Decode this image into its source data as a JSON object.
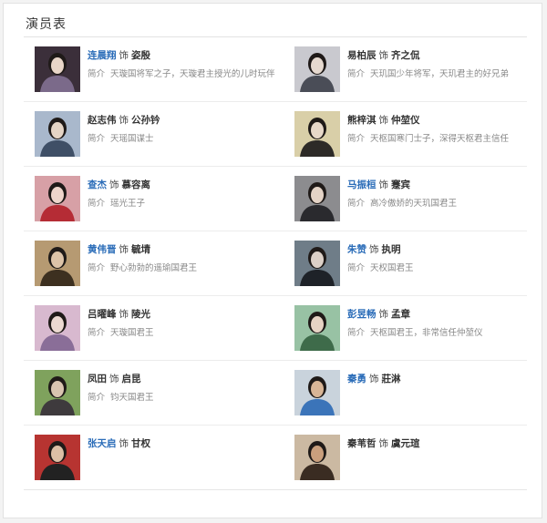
{
  "panel": {
    "title": "演员表"
  },
  "intro_label": "简介",
  "shi": "饰",
  "rows": [
    {
      "left": {
        "actor": "连晨翔",
        "linked": true,
        "role": "姿殷",
        "intro": "天璇国将军之子，天璇君主授光的儿时玩伴",
        "palette": [
          "#3b2f3a",
          "#7b6a8a",
          "#e9d6c8"
        ]
      },
      "right": {
        "actor": "易柏辰",
        "linked": false,
        "role": "齐之侃",
        "intro": "天玑国少年将军，天玑君主的好兄弟",
        "palette": [
          "#c9c9cf",
          "#4a4d57",
          "#e6d9cf"
        ]
      }
    },
    {
      "left": {
        "actor": "赵志伟",
        "linked": false,
        "role": "公孙钤",
        "intro": "天瑶国谋士",
        "palette": [
          "#a9b8cc",
          "#3f4f66",
          "#e5d4c5"
        ]
      },
      "right": {
        "actor": "熊梓淇",
        "linked": false,
        "role": "仲堃仪",
        "intro": "天枢国寒门士子，深得天枢君主信任",
        "palette": [
          "#d9cfa8",
          "#2d2a27",
          "#e7d8c9"
        ]
      }
    },
    {
      "left": {
        "actor": "查杰",
        "linked": true,
        "role": "慕容离",
        "intro": "瑶光王子",
        "palette": [
          "#d7a0a6",
          "#b52c35",
          "#eed5cb"
        ]
      },
      "right": {
        "actor": "马振桓",
        "linked": true,
        "role": "蹇宾",
        "intro": "高冷傲娇的天玑国君王",
        "palette": [
          "#8c8c8f",
          "#2a2a2e",
          "#e4d3c6"
        ]
      }
    },
    {
      "left": {
        "actor": "黄伟晋",
        "linked": true,
        "role": "毓埥",
        "intro": "野心勃勃的遥瑜国君王",
        "palette": [
          "#b69a72",
          "#3d3020",
          "#dcc3a8"
        ]
      },
      "right": {
        "actor": "朱赞",
        "linked": true,
        "role": "执明",
        "intro": "天权国君王",
        "palette": [
          "#6f7d88",
          "#1e2228",
          "#dcd0c7"
        ]
      }
    },
    {
      "left": {
        "actor": "吕曜峰",
        "linked": false,
        "role": "陵光",
        "intro": "天璇国君王",
        "palette": [
          "#d8b9cf",
          "#8a6e98",
          "#ecd9d1"
        ]
      },
      "right": {
        "actor": "彭昱畅",
        "linked": true,
        "role": "孟章",
        "intro": "天枢国君王，非常信任仲堃仪",
        "palette": [
          "#98c2a4",
          "#3e6b4a",
          "#e6d3c4"
        ]
      }
    },
    {
      "left": {
        "actor": "凤田",
        "linked": false,
        "role": "启昆",
        "intro": "钧天国君王",
        "palette": [
          "#7fa25d",
          "#3e3a3d",
          "#d9c4b0"
        ]
      },
      "right": {
        "actor": "秦勇",
        "linked": true,
        "role": "莊淋",
        "intro": "",
        "palette": [
          "#c9d3dc",
          "#3b74b9",
          "#d8b596"
        ]
      }
    },
    {
      "left": {
        "actor": "张天启",
        "linked": true,
        "role": "甘权",
        "intro": "",
        "palette": [
          "#b73431",
          "#222222",
          "#dcbfa5"
        ]
      },
      "right": {
        "actor": "秦苇哲",
        "linked": false,
        "role": "虞元瑄",
        "intro": "",
        "palette": [
          "#cbb9a2",
          "#3a2c22",
          "#c99f7d"
        ]
      }
    }
  ]
}
